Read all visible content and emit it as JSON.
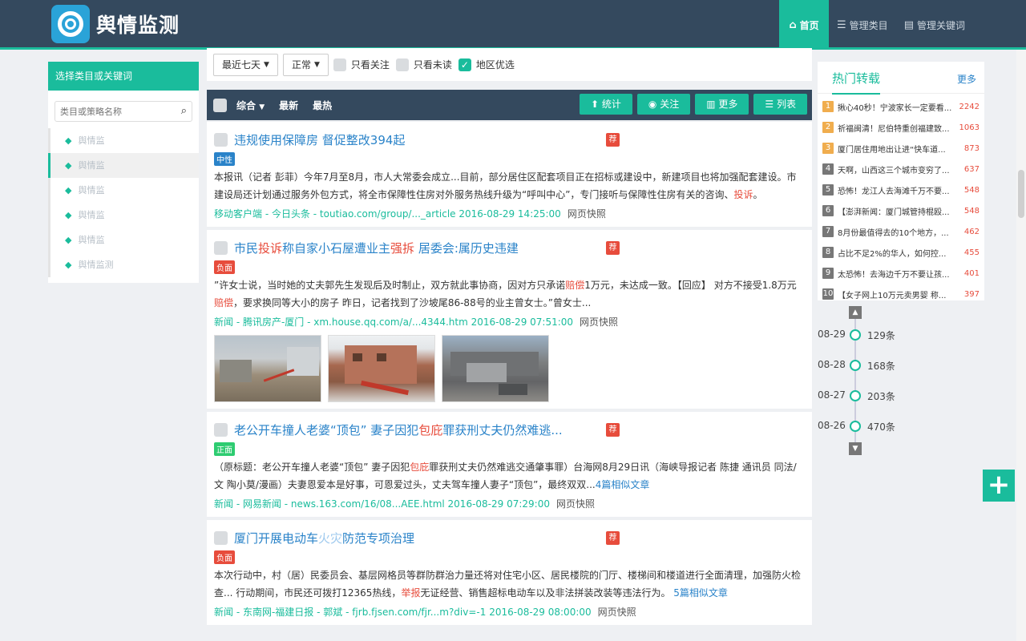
{
  "header": {
    "logo_text": "舆情监测",
    "nav": [
      {
        "label": "首页",
        "icon": "home-icon"
      },
      {
        "label": "管理类目",
        "icon": "list-icon"
      },
      {
        "label": "管理关键词",
        "icon": "document-icon"
      }
    ]
  },
  "sidebar": {
    "title": "选择类目或关键词",
    "search_placeholder": "类目或策略名称",
    "items": [
      {
        "label": "舆情监"
      },
      {
        "label": "舆情监"
      },
      {
        "label": "舆情监"
      },
      {
        "label": "舆情监"
      },
      {
        "label": "舆情监"
      },
      {
        "label": "舆情监测"
      }
    ]
  },
  "filters": {
    "range": "最近七天",
    "status": "正常",
    "only_follow": "只看关注",
    "only_unread": "只看未读",
    "region_first": "地区优选"
  },
  "toolbar": {
    "sort_all": "综合",
    "latest": "最新",
    "hottest": "最热",
    "stats": "统计",
    "follow": "关注",
    "more": "更多",
    "list": "列表"
  },
  "articles": [
    {
      "title": "违规使用保障房 督促整改394起",
      "badge": "荐",
      "tag": "中性",
      "body": "本报讯（记者 彭菲）今年7月至8月，市人大常委会成立...目前，部分居住区配套项目正在招标或建设中，新建项目也将加强配套建设。市建设局还计划通过服务外包方式，将全市保障性住房对外服务热线升级为“呼叫中心”，专门接听与保障性住房有关的咨询、",
      "body_red": "投诉",
      "body_end": "。",
      "meta": "移动客户端 - 今日头条 - toutiao.com/group/..._article  2016-08-29 14:25:00",
      "snapshot": "网页快照"
    },
    {
      "title_1": "市民",
      "title_red_1": "投诉",
      "title_2": "称自家小石屋遭业主",
      "title_red_2": "强拆",
      "title_3": " 居委会:属历史违建",
      "badge": "荐",
      "tag": "负面",
      "body_1": "”许女士说，当时她的丈夫郭先生发现后及时制止，双方就此事协商，因对方只承诺",
      "body_red_1": "赔偿",
      "body_2": "1万元，未达成一致。【回应】 对方不接受1.8万元",
      "body_red_2": "赔偿",
      "body_3": "，要求换同等大小的房子 昨日，记者找到了沙坡尾86-88号的业主曾女士。”曾女士...",
      "meta": "新闻 - 腾讯房产-厦门 - xm.house.qq.com/a/...4344.htm  2016-08-29 07:51:00",
      "snapshot": "网页快照"
    },
    {
      "title_1": "老公开车撞人老婆“顶包” 妻子因犯",
      "title_red": "包庇",
      "title_2": "罪获刑丈夫仍然难逃...",
      "badge": "荐",
      "tag": "正面",
      "body_1": "（原标题：老公开车撞人老婆“顶包” 妻子因犯",
      "body_red": "包庇",
      "body_2": "罪获刑丈夫仍然难逃交通肇事罪）台海网8月29日讯（海峡导报记者 陈捷 通讯员 同法/文 陶小莫/漫画）夫妻恩爱本是好事，可恩爱过头，丈夫驾车撞人妻子“顶包”，最终双双...",
      "similar": "4篇相似文章",
      "meta": "新闻 - 网易新闻 - news.163.com/16/08...AEE.html  2016-08-29 07:29:00",
      "snapshot": "网页快照"
    },
    {
      "title_1": "厦门开展电动车",
      "title_blur": "火灾",
      "title_2": "防范专项治理",
      "badge": "荐",
      "tag": "负面",
      "body_1": "本次行动中，村（居）民委员会、基层网格员等群防群治力量还将对住宅小区、居民楼院的门厅、楼梯间和楼道进行全面清理，加强防火检查... 行动期间，市民还可拨打12365热线，",
      "body_red": "举报",
      "body_2": "无证经营、销售超标电动车以及非法拼装改装等违法行为。",
      "similar": "5篇相似文章",
      "meta": "新闻 - 东南网-福建日报 - 郭斌 - fjrb.fjsen.com/fjr...m?div=-1  2016-08-29 08:00:00",
      "snapshot": "网页快照"
    }
  ],
  "hot": {
    "title": "热门转载",
    "more": "更多",
    "items": [
      {
        "rank": "1",
        "text": "揪心40秒！宁波家长一定要看...",
        "count": "2242"
      },
      {
        "rank": "2",
        "text": "祈福闽清！尼伯特重创福建致...",
        "count": "1063"
      },
      {
        "rank": "3",
        "text": "厦门居住用地出让进“快车道...",
        "count": "873"
      },
      {
        "rank": "4",
        "text": "天啊，山西这三个城市变穷了...",
        "count": "637"
      },
      {
        "rank": "5",
        "text": "恐怖！龙江人去海滩千万不要...",
        "count": "548"
      },
      {
        "rank": "6",
        "text": "【澎湃新闻：厦门城管持棍殴...",
        "count": "548"
      },
      {
        "rank": "7",
        "text": "8月份最值得去的10个地方，...",
        "count": "462"
      },
      {
        "rank": "8",
        "text": "占比不足2%的华人，如何控...",
        "count": "455"
      },
      {
        "rank": "9",
        "text": "太恐怖！去海边千万不要让孩...",
        "count": "401"
      },
      {
        "rank": "10",
        "text": "【女子网上10万元卖男婴 称...",
        "count": "397"
      }
    ]
  },
  "timeline": [
    {
      "date": "08-29",
      "count": "129条"
    },
    {
      "date": "08-28",
      "count": "168条"
    },
    {
      "date": "08-27",
      "count": "203条"
    },
    {
      "date": "08-26",
      "count": "470条"
    }
  ],
  "colors": {
    "accent": "#1abc9c",
    "header": "#34495e",
    "link": "#2a83c9",
    "alert": "#e74c3c"
  }
}
